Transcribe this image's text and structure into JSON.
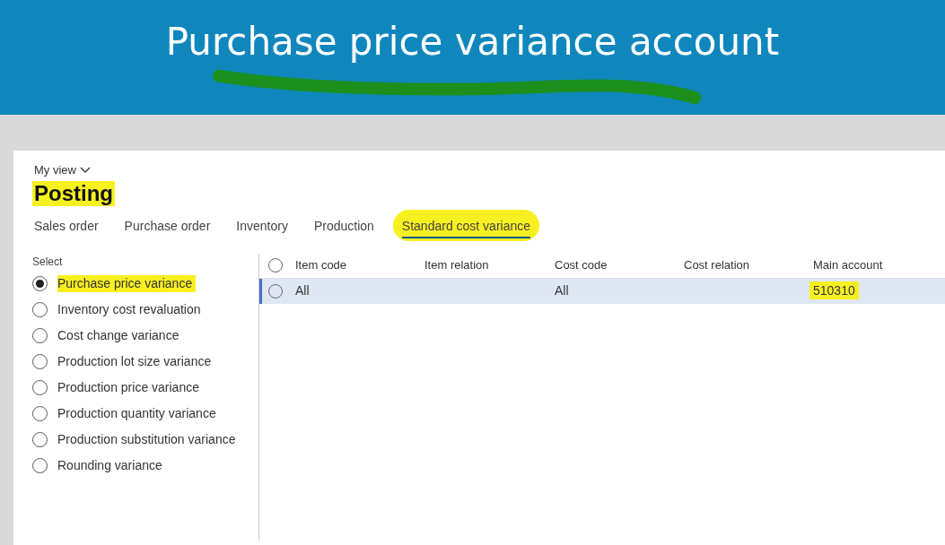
{
  "banner": {
    "title": "Purchase price variance account"
  },
  "page": {
    "view_menu": "My view",
    "title": "Posting"
  },
  "tabs": [
    {
      "label": "Sales order",
      "selected": false
    },
    {
      "label": "Purchase order",
      "selected": false
    },
    {
      "label": "Inventory",
      "selected": false
    },
    {
      "label": "Production",
      "selected": false
    },
    {
      "label": "Standard cost variance",
      "selected": true
    }
  ],
  "select": {
    "label": "Select",
    "options": [
      {
        "label": "Purchase price variance",
        "selected": true
      },
      {
        "label": "Inventory cost revaluation",
        "selected": false
      },
      {
        "label": "Cost change variance",
        "selected": false
      },
      {
        "label": "Production lot size variance",
        "selected": false
      },
      {
        "label": "Production price variance",
        "selected": false
      },
      {
        "label": "Production quantity variance",
        "selected": false
      },
      {
        "label": "Production substitution variance",
        "selected": false
      },
      {
        "label": "Rounding variance",
        "selected": false
      }
    ]
  },
  "grid": {
    "select_all": {
      "selected": false
    },
    "columns": [
      "Item code",
      "Item relation",
      "Cost code",
      "Cost relation",
      "Main account"
    ],
    "rows": [
      {
        "selected": true,
        "item_code": "All",
        "cost_code": "All",
        "main_account": "510310"
      }
    ]
  }
}
